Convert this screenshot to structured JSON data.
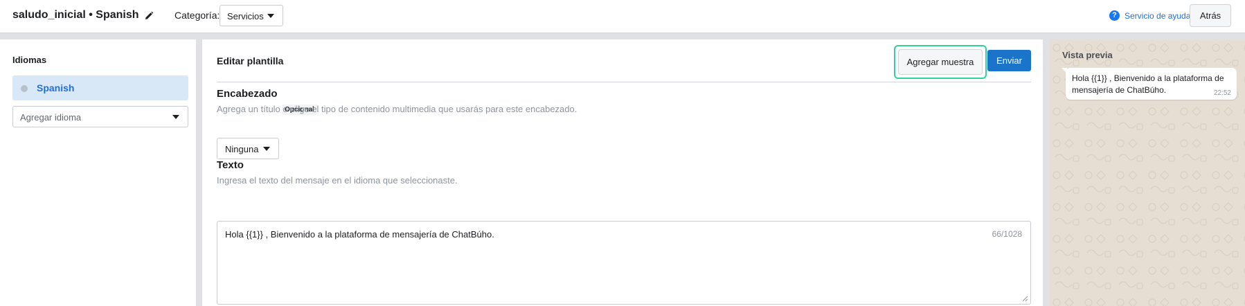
{
  "header": {
    "template_title": "saludo_inicial • Spanish",
    "category_label": "Categoría:",
    "category_value": "Servicios",
    "help_label": "Servicio de ayuda",
    "back_label": "Atrás"
  },
  "sidebar": {
    "heading": "Idiomas",
    "selected_language": "Spanish",
    "add_language_placeholder": "Agregar idioma"
  },
  "editor": {
    "title": "Editar plantilla",
    "add_sample_label": "Agregar muestra",
    "send_label": "Enviar",
    "header_section": {
      "title": "Encabezado",
      "optional_tag": "Opcional",
      "description": "Agrega un título o elige el tipo de contenido multimedia que usarás para este encabezado.",
      "media_type_value": "Ninguna"
    },
    "body_section": {
      "title": "Texto",
      "description": "Ingresa el texto del mensaje en el idioma que seleccionaste.",
      "value": "Hola {{1}} , Bienvenido a la plataforma de mensajería de ChatBúho.",
      "char_count": "66/1028"
    }
  },
  "preview": {
    "title": "Vista previa",
    "message_text": "Hola {{1}} , Bienvenido a la plataforma de mensajería de ChatBúho.",
    "message_time": "22:52"
  },
  "colors": {
    "accent": "#1a74c9",
    "focus_ring": "#2cd49a",
    "selected_bg": "#d8e8f6",
    "preview_bg": "#e6ddd3"
  },
  "icons": [
    "pencil-icon",
    "help-icon",
    "chevron-down-icon",
    "status-dot-icon",
    "resize-grip-icon"
  ]
}
